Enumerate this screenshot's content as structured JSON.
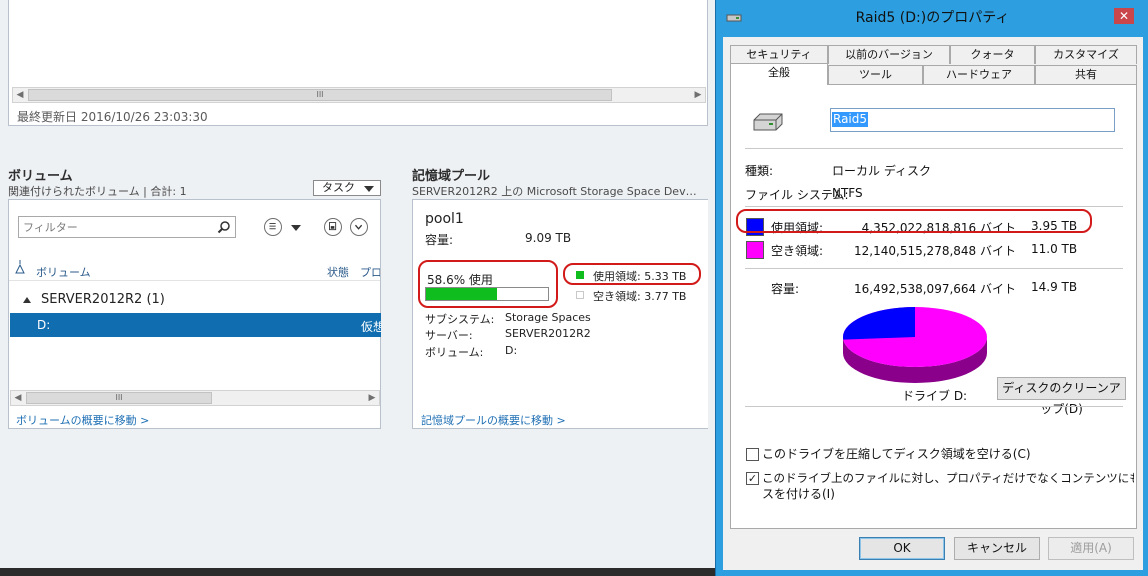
{
  "server_manager": {
    "last_updated": "最終更新日 2016/10/26 23:03:30",
    "volumes": {
      "title": "ボリューム",
      "subtitle": "関連付けられたボリューム | 合計: 1",
      "tasks_label": "タスク",
      "filter_placeholder": "フィルター",
      "columns": [
        "ボリューム",
        "状態",
        "プロ"
      ],
      "group_label": "SERVER2012R2 (1)",
      "rows": [
        {
          "volume": "D:",
          "type": "仮想"
        }
      ],
      "overview_link": "ボリュームの概要に移動 >"
    },
    "storage_pool": {
      "title": "記憶域プール",
      "subtitle": "SERVER2012R2 上の Microsoft Storage Space Dev…",
      "name": "pool1",
      "capacity_label": "容量:",
      "capacity_value": "9.09 TB",
      "usage_text": "58.6% 使用",
      "usage_fraction": 0.586,
      "used_label": "使用領域: 5.33 TB",
      "free_label": "空き領域: 3.77 TB",
      "used_color": "#0fbd1f",
      "details": [
        {
          "key": "サブシステム:",
          "value": "Storage Spaces"
        },
        {
          "key": "サーバー:",
          "value": "SERVER2012R2"
        },
        {
          "key": "ボリューム:",
          "value": "D:"
        }
      ],
      "overview_link": "記憶域プールの概要に移動 >"
    }
  },
  "properties_dialog": {
    "title": "Raid5 (D:)のプロパティ",
    "tabs_row1": [
      "セキュリティ",
      "以前のバージョン",
      "クォータ",
      "カスタマイズ"
    ],
    "tabs_row2": [
      "全般",
      "ツール",
      "ハードウェア",
      "共有"
    ],
    "active_tab": "全般",
    "volume_label": "Raid5",
    "type_label": "種類:",
    "type_value": "ローカル ディスク",
    "fs_label": "ファイル システム:",
    "fs_value": "NTFS",
    "used": {
      "label": "使用領域:",
      "bytes": "4,352,022,818,816 バイト",
      "size": "3.95 TB",
      "color": "#0000ff"
    },
    "free": {
      "label": "空き領域:",
      "bytes": "12,140,515,278,848 バイト",
      "size": "11.0 TB",
      "color": "#ff00ff"
    },
    "capacity": {
      "label": "容量:",
      "bytes": "16,492,538,097,664 バイト",
      "size": "14.9 TB"
    },
    "used_fraction": 0.264,
    "drive_label": "ドライブ D:",
    "cleanup_button": "ディスクのクリーンアップ(D)",
    "compress_checkbox": {
      "label": "このドライブを圧縮してディスク領域を空ける(C)",
      "checked": false
    },
    "index_checkbox": {
      "label_line1": "このドライブ上のファイルに対し、プロパティだけでなくコンテンツにもインデックス",
      "label_line2": "スを付ける(I)",
      "checked": true
    },
    "ok_button": "OK",
    "cancel_button": "キャンセル",
    "apply_button": "適用(A)"
  }
}
